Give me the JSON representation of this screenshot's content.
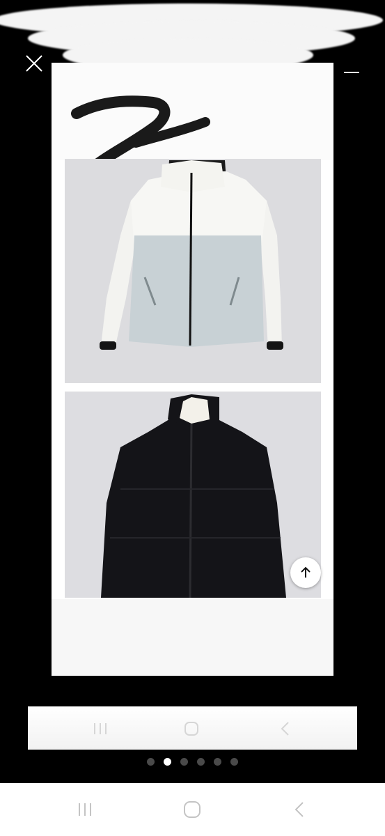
{
  "viewer": {
    "close_icon": "close-icon",
    "menu_icon": "menu-icon",
    "scroll_top_icon": "arrow-up-icon"
  },
  "images": [
    {
      "name": "jacket-white-fleece",
      "colors": {
        "upper": "#f6f6f3",
        "lower": "#c9d3d6",
        "trim": "#111111"
      }
    },
    {
      "name": "jacket-black-padded",
      "colors": {
        "body": "#141418",
        "collar": "#f3f1ea"
      }
    }
  ],
  "pager": {
    "count": 6,
    "active_index": 1
  },
  "system_nav": {
    "recents_icon": "recents-icon",
    "home_icon": "home-icon",
    "back_icon": "back-icon"
  }
}
